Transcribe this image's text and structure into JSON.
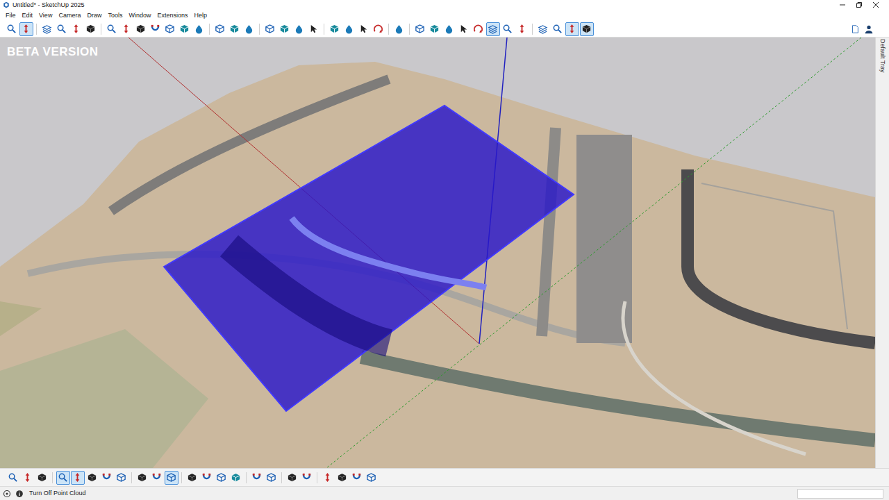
{
  "window": {
    "title": "Untitled* - SketchUp 2025"
  },
  "menu": [
    "File",
    "Edit",
    "View",
    "Camera",
    "Draw",
    "Tools",
    "Window",
    "Extensions",
    "Help"
  ],
  "toolbar": {
    "groups": [
      [
        {
          "selected": false
        },
        {
          "selected": true
        }
      ],
      [
        {
          "selected": false
        },
        {
          "selected": false
        },
        {
          "selected": false
        },
        {
          "selected": false
        }
      ],
      [
        {
          "selected": false
        },
        {
          "selected": false
        },
        {
          "selected": false
        },
        {
          "selected": false
        },
        {
          "selected": false
        },
        {
          "selected": false
        },
        {
          "selected": false
        }
      ],
      [
        {
          "selected": false
        },
        {
          "selected": false
        },
        {
          "selected": false
        }
      ],
      [
        {
          "selected": false
        },
        {
          "selected": false
        },
        {
          "selected": false
        },
        {
          "selected": false
        }
      ],
      [
        {
          "selected": false
        },
        {
          "selected": false
        },
        {
          "selected": false
        },
        {
          "selected": false
        }
      ],
      [
        {
          "selected": false
        }
      ],
      [
        {
          "selected": false
        },
        {
          "selected": false
        },
        {
          "selected": false
        },
        {
          "selected": false
        },
        {
          "selected": false
        },
        {
          "selected": true
        },
        {
          "selected": false
        },
        {
          "selected": false
        }
      ],
      [
        {
          "selected": false
        },
        {
          "selected": false
        },
        {
          "selected": true
        },
        {
          "selected": true
        }
      ]
    ]
  },
  "viewport": {
    "overlay": "BETA VERSION"
  },
  "tray": {
    "label": "Default Tray"
  },
  "bottom_toolbar": {
    "groups": [
      [
        {
          "selected": false
        },
        {
          "selected": false
        },
        {
          "selected": false
        }
      ],
      [
        {
          "selected": true
        },
        {
          "selected": true
        },
        {
          "selected": false
        },
        {
          "selected": false
        },
        {
          "selected": false
        }
      ],
      [
        {
          "selected": false
        },
        {
          "selected": false
        },
        {
          "selected": true
        }
      ],
      [
        {
          "selected": false
        },
        {
          "selected": false
        },
        {
          "selected": false
        },
        {
          "selected": false
        }
      ],
      [
        {
          "selected": false
        },
        {
          "selected": false
        }
      ],
      [
        {
          "selected": false
        },
        {
          "selected": false
        }
      ],
      [
        {
          "selected": false
        },
        {
          "selected": false
        },
        {
          "selected": false
        },
        {
          "selected": false
        }
      ]
    ]
  },
  "status_bar": {
    "text": "Turn Off Point Cloud",
    "measurements": ""
  }
}
